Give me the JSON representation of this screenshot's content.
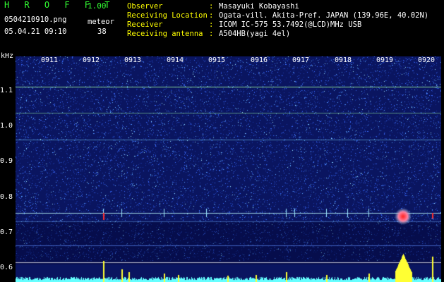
{
  "app": {
    "brand": "H R O F F T",
    "version": "1.00"
  },
  "file": {
    "filename": "0504210910.png",
    "datetime": "05.04.21 09:10"
  },
  "meteor": {
    "label": "meteor",
    "count": "38"
  },
  "info": [
    {
      "label": "Observer",
      "sep": ":",
      "value": "Masayuki Kobayashi"
    },
    {
      "label": "Receiving Location",
      "sep": ":",
      "value": "Ogata-vill. Akita-Pref. JAPAN (139.96E, 40.02N)"
    },
    {
      "label": "Receiver",
      "sep": ":",
      "value": "ICOM IC-575 53.7492(@LCD)MHz USB"
    },
    {
      "label": "Receiving antenna",
      "sep": ":",
      "value": "A504HB(yagi 4el)"
    }
  ],
  "axes": {
    "freq_unit": "kHz",
    "freq_ticks": [
      "1.1",
      "1.0",
      "0.9",
      "0.8",
      "0.7",
      "0.6"
    ],
    "time_ticks": [
      "0911",
      "0912",
      "0913",
      "0914",
      "0915",
      "0916",
      "0917",
      "0918",
      "0919",
      "0920"
    ]
  },
  "colors": {
    "background": "#000000",
    "brand_green": "#33ff33",
    "label_yellow": "#ffff00",
    "header_white": "#ffffff",
    "noise_dark": "#10207a",
    "noise_light": "#3a6cff",
    "echo_red": "#ff3030",
    "bar_yellow": "#ffff33",
    "bar_cyan": "#66ffff"
  }
}
